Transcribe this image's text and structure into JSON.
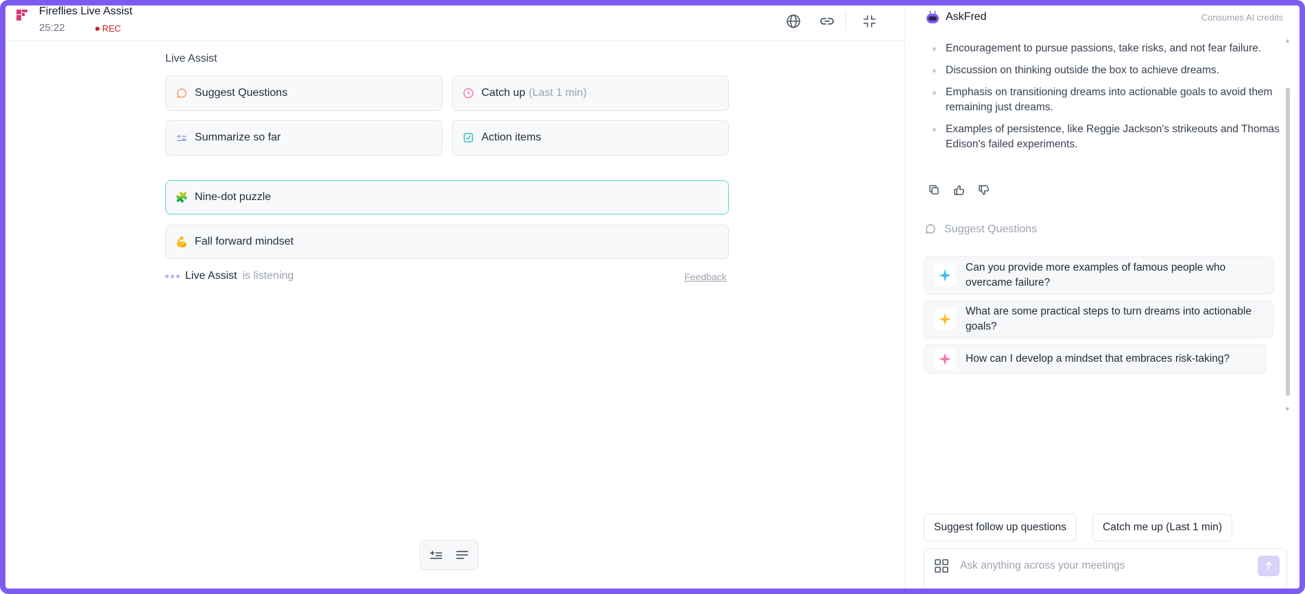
{
  "header": {
    "app_title": "Fireflies Live Assist",
    "timer": "25:22",
    "rec_label": "REC",
    "icons": [
      "globe-icon",
      "link-icon",
      "minimize-icon"
    ]
  },
  "live_assist": {
    "title": "Live Assist",
    "cards": [
      {
        "label": "Suggest Questions",
        "icon": "chat-bubble-icon"
      },
      {
        "label": "Catch up",
        "suffix": "(Last 1 min)",
        "icon": "clock-icon"
      },
      {
        "label": "Summarize so far",
        "icon": "summary-list-icon"
      },
      {
        "label": "Action items",
        "icon": "checkbox-icon"
      }
    ],
    "topics": [
      {
        "label": "Nine-dot puzzle",
        "emoji": "🧩"
      },
      {
        "label": "Fall forward mindset",
        "emoji": "💪"
      }
    ],
    "status_name": "Live Assist",
    "status_text": "is listening",
    "feedback_label": "Feedback"
  },
  "askfred": {
    "name": "AskFred",
    "credits": "Consumes AI credits",
    "bullets": [
      "Encouragement to pursue passions, take risks, and not fear failure.",
      "Discussion on thinking outside the box to achieve dreams.",
      "Emphasis on transitioning dreams into actionable goals to avoid them remaining just dreams.",
      "Examples of persistence, like Reggie Jackson's strikeouts and Thomas Edison's failed experiments."
    ],
    "suggest_title": "Suggest Questions",
    "questions": [
      {
        "text": "Can you provide more examples of famous people who overcame failure?",
        "color": "#38bdf8"
      },
      {
        "text": "What are some practical steps to turn dreams into actionable goals?",
        "color": "#fbbf24"
      },
      {
        "text": "How can I develop a mindset that embraces risk-taking?",
        "color": "#f472b6"
      }
    ],
    "chips": [
      "Suggest follow up questions",
      "Catch me up (Last 1 min)"
    ],
    "ask_placeholder": "Ask anything across your meetings"
  },
  "colors": {
    "accent": "#7c5cf0",
    "rec": "#c81e1e",
    "highlight_border": "#5fd6cf"
  }
}
